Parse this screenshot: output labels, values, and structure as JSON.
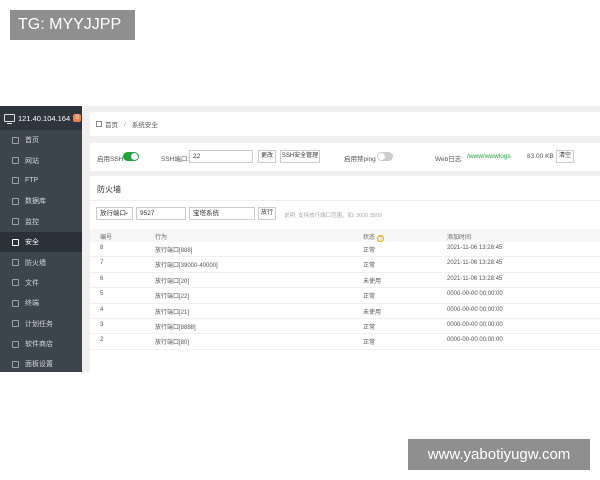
{
  "watermarks": {
    "top_left": "TG: MYYJJPP",
    "bottom_right": "www.yabotiyugw.com"
  },
  "sidebar": {
    "ip": "121.40.104.164",
    "badge": "0",
    "items": [
      {
        "label": "首页",
        "icon": "home-icon"
      },
      {
        "label": "网站",
        "icon": "globe-icon"
      },
      {
        "label": "FTP",
        "icon": "ftp-icon"
      },
      {
        "label": "数据库",
        "icon": "database-icon"
      },
      {
        "label": "监控",
        "icon": "monitor-icon"
      },
      {
        "label": "安全",
        "icon": "shield-icon",
        "active": true
      },
      {
        "label": "防火墙",
        "icon": "firewall-icon"
      },
      {
        "label": "文件",
        "icon": "folder-icon"
      },
      {
        "label": "终端",
        "icon": "terminal-icon"
      },
      {
        "label": "计划任务",
        "icon": "clock-icon"
      },
      {
        "label": "软件商店",
        "icon": "store-icon"
      },
      {
        "label": "面板设置",
        "icon": "gear-icon"
      }
    ]
  },
  "breadcrumb": {
    "home": "首页",
    "separator": "/",
    "current": "系统安全"
  },
  "toolbar": {
    "ssh_label": "启用SSH",
    "ssh_enabled": true,
    "port_label": "SSH端口:",
    "port_value": "22",
    "change_btn": "更改",
    "ssh_mgmt_btn": "SSH安全管理",
    "ping_label": "启用禁ping",
    "ping_enabled": false,
    "weblog_label": "Web日志:",
    "weblog_path": "/www/wwwlogs",
    "weblog_size": "83.00 KB",
    "clear_btn": "清空"
  },
  "firewall": {
    "title": "防火墙",
    "select_value": "放行端口",
    "port_input": "9527",
    "remark_input": "宝塔系统",
    "add_btn": "放行",
    "hint": "说明: 支持放行端口范围，如: 3000:3500",
    "columns": [
      "编号",
      "行为",
      "状态",
      "添加时间"
    ],
    "rows": [
      {
        "id": "8",
        "action": "放行端口[888]",
        "status": "正常",
        "time": "2021-11-06 13:28:45"
      },
      {
        "id": "7",
        "action": "放行端口[39000-40000]",
        "status": "正常",
        "time": "2021-11-06 13:28:45"
      },
      {
        "id": "6",
        "action": "放行端口[20]",
        "status": "未使用",
        "time": "2021-11-06 13:28:45"
      },
      {
        "id": "5",
        "action": "放行端口[22]",
        "status": "正常",
        "time": "0000-00-00 00:00:00"
      },
      {
        "id": "4",
        "action": "放行端口[21]",
        "status": "未使用",
        "time": "0000-00-00 00:00:00"
      },
      {
        "id": "3",
        "action": "放行端口[8888]",
        "status": "正常",
        "time": "0000-00-00 00:00:00"
      },
      {
        "id": "2",
        "action": "放行端口[80]",
        "status": "正常",
        "time": "0000-00-00 00:00:00"
      }
    ]
  },
  "colors": {
    "accent": "#20a53a",
    "sidebar_bg": "#3c444d",
    "badge": "#e8824a"
  }
}
